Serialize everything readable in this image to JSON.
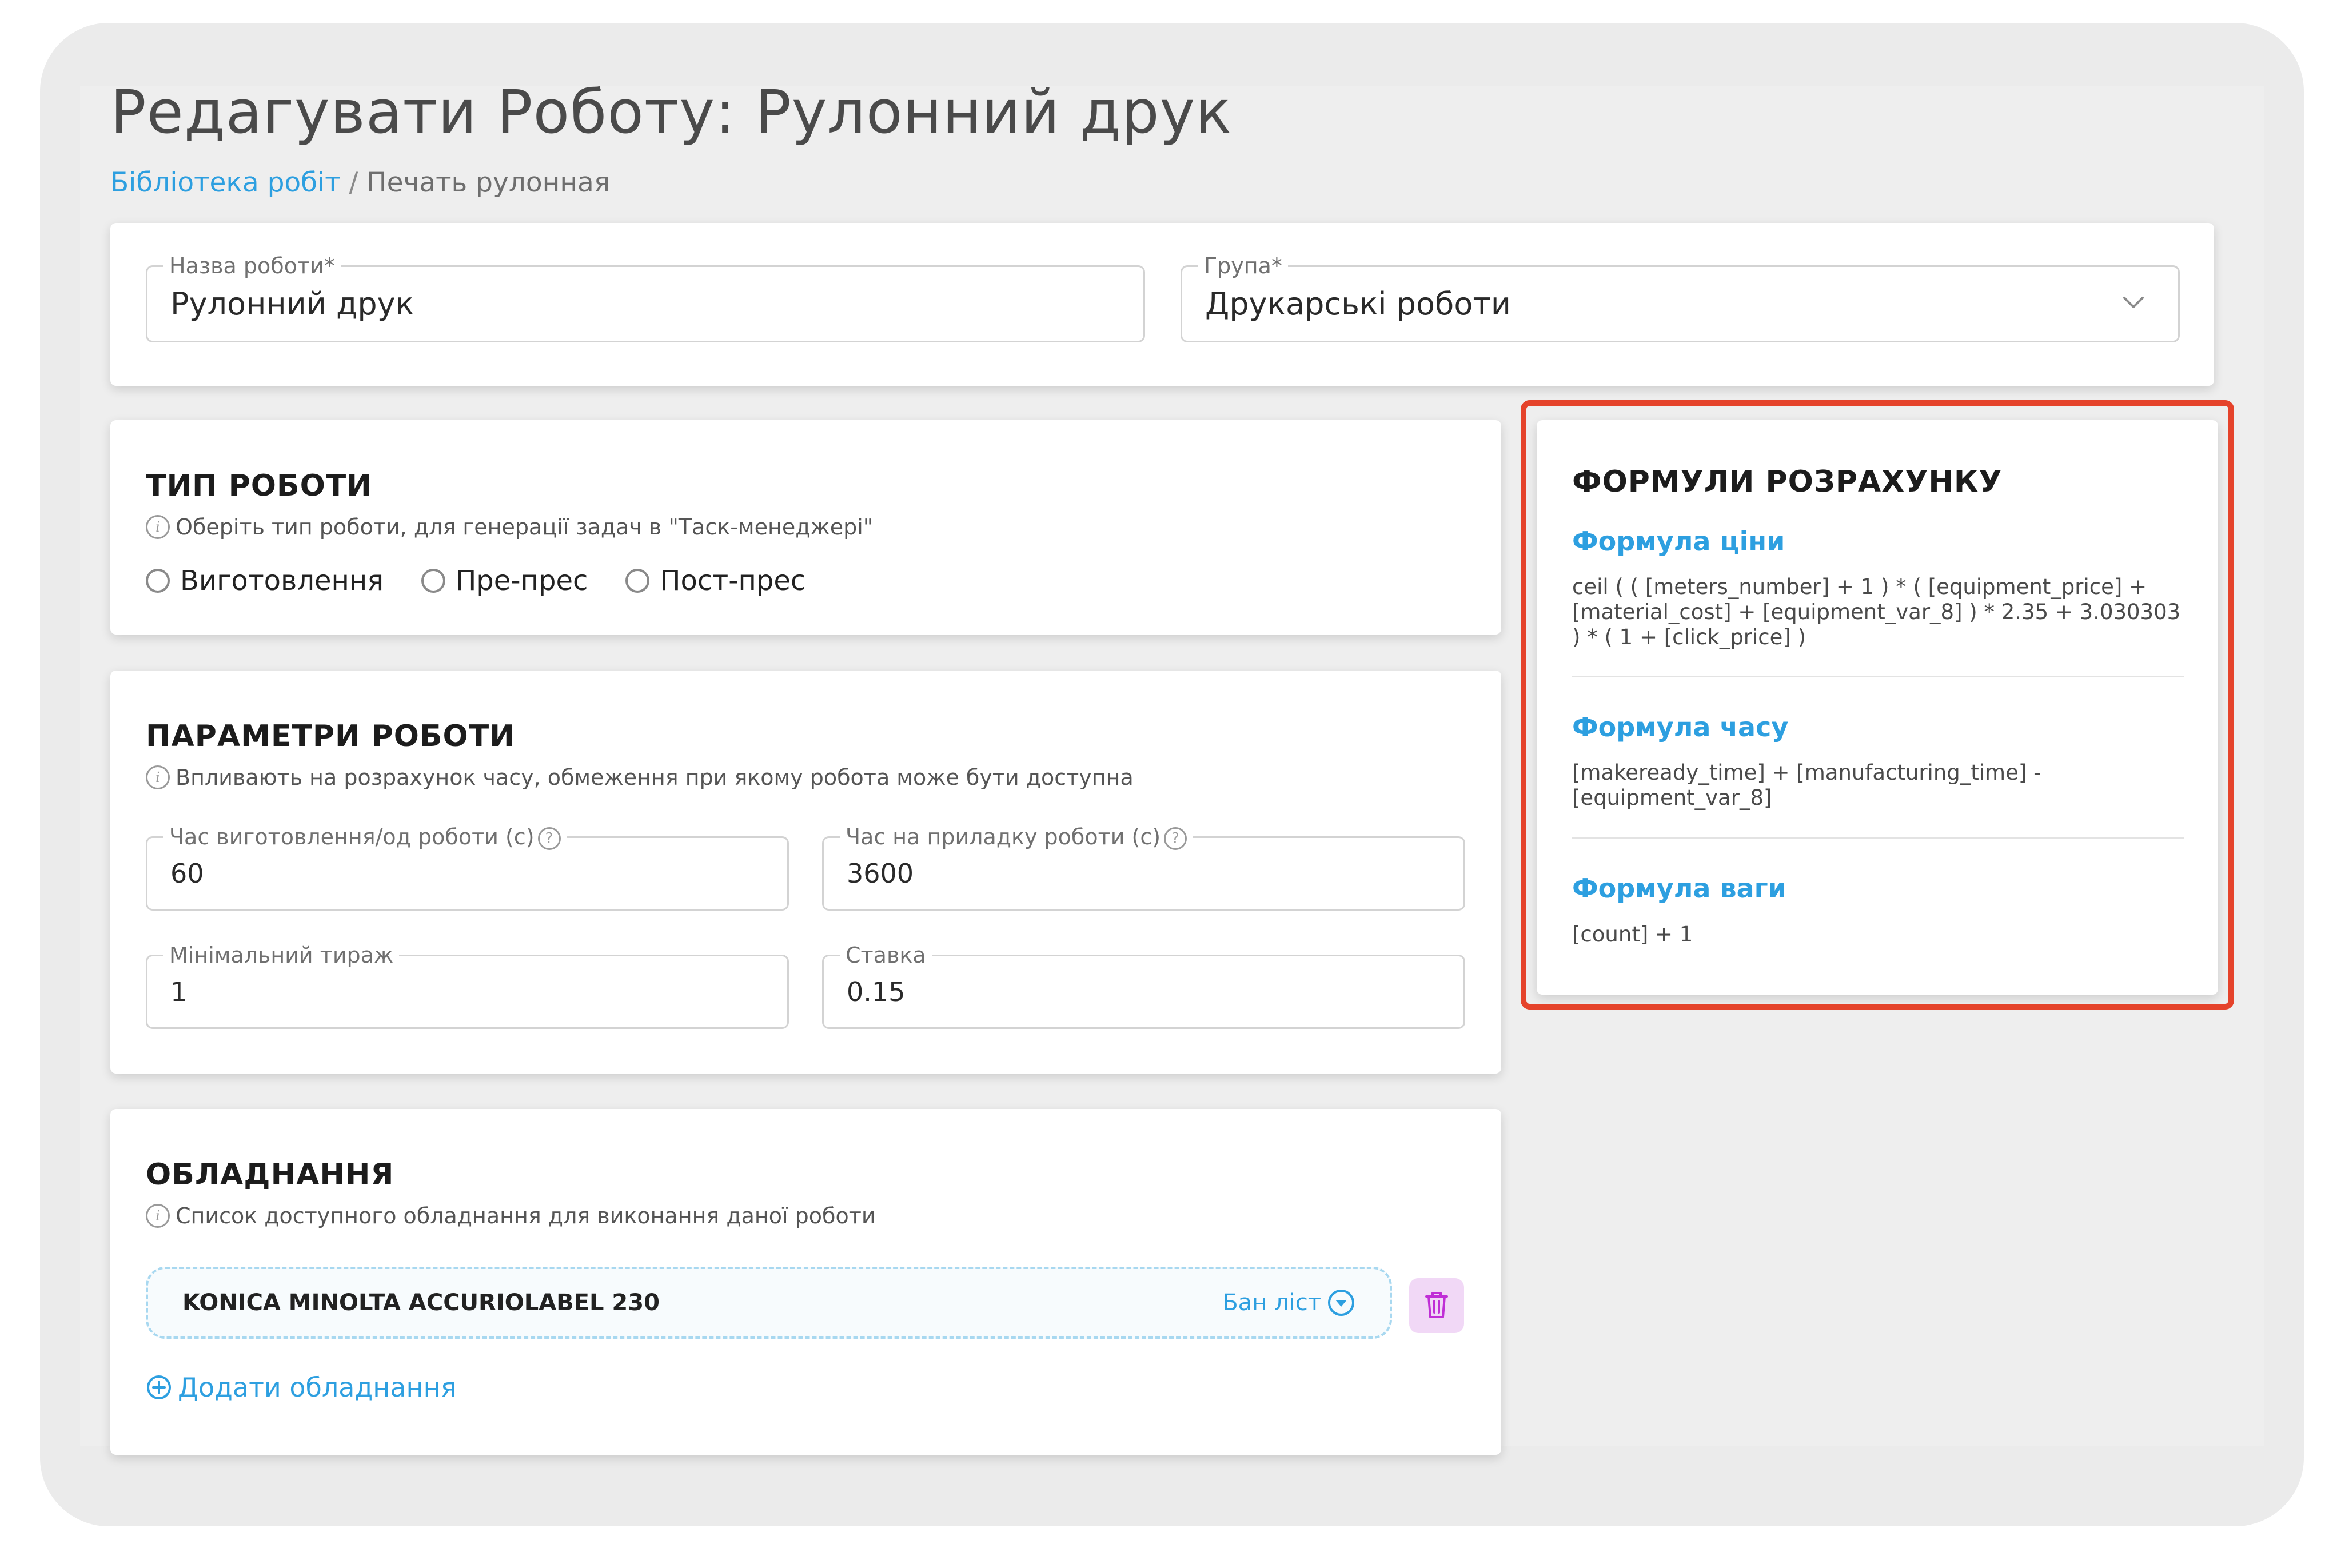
{
  "page": {
    "title": "Редагувати Роботу:  Рулонний друк",
    "breadcrumb": {
      "link": "Бібліотека робіт",
      "separator": " / ",
      "current": "Печать рулонная"
    }
  },
  "top_form": {
    "name": {
      "label": "Назва роботи*",
      "value": "Рулонний друк"
    },
    "group": {
      "label": "Група*",
      "value": "Друкарські роботи",
      "icon": "chevron-down-icon"
    }
  },
  "work_type": {
    "title": "ТИП РОБОТИ",
    "hint": "Оберіть тип роботи, для генерації задач в \"Таск-менеджері\"",
    "options": [
      {
        "label": "Виготовлення",
        "selected": false
      },
      {
        "label": "Пре-прес",
        "selected": false
      },
      {
        "label": "Пост-прес",
        "selected": false
      }
    ]
  },
  "params": {
    "title": "ПАРАМЕТРИ РОБОТИ",
    "hint": "Впливають на розрахунок часу, обмеження при якому робота може бути доступна",
    "fields": [
      {
        "label": "Час виготовлення/од роботи (с)",
        "value": "60",
        "help": "?"
      },
      {
        "label": "Час на приладку роботи (с)",
        "value": "3600",
        "help": "?"
      },
      {
        "label": "Мінімальний тираж",
        "value": "1"
      },
      {
        "label": "Ставка",
        "value": "0.15"
      }
    ]
  },
  "equipment": {
    "title": "ОБЛАДНАННЯ",
    "hint": "Список доступного обладнання для виконання даної роботи",
    "items": [
      {
        "name": "KONICA MINOLTA ACCURIOLABEL 230",
        "tag": "Бан ліст",
        "tag_icon": "chevron-circle-down-icon",
        "delete_icon": "trash-icon"
      }
    ],
    "add_label": "Додати обладнання"
  },
  "formulas": {
    "title": "ФОРМУЛИ РОЗРАХУНКУ",
    "items": [
      {
        "label": "Формула ціни",
        "text": "ceil ( ( [meters_number] + 1 ) * ( [equipment_price] + [material_cost] + [equipment_var_8] ) * 2.35 + 3.030303 ) * ( 1 + [click_price] )"
      },
      {
        "label": "Формула часу",
        "text": "[makeready_time] + [manufacturing_time] - [equipment_var_8]"
      },
      {
        "label": "Формула ваги",
        "text": "[count] + 1"
      }
    ],
    "highlight_color": "#e5432b"
  },
  "colors": {
    "accent": "#2d9fe0",
    "delete_bg": "#f1d8f6",
    "delete_icon": "#c02fd6"
  }
}
